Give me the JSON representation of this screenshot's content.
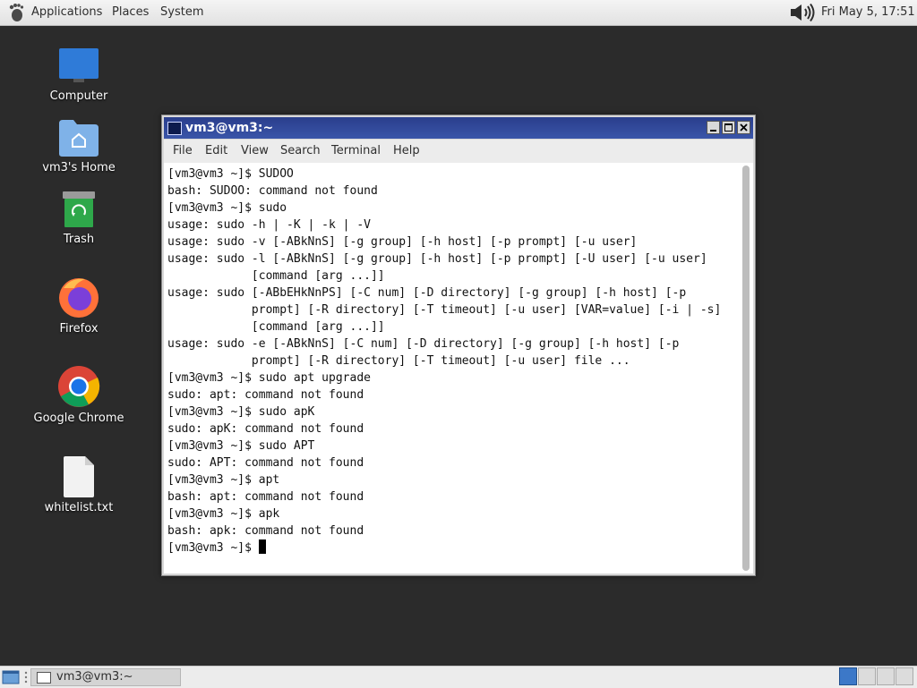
{
  "top_panel": {
    "applications": "Applications",
    "places": "Places",
    "system": "System",
    "clock": "Fri May  5, 17:51"
  },
  "desktop": {
    "icons": [
      {
        "label": "Computer"
      },
      {
        "label": "vm3's Home"
      },
      {
        "label": "Trash"
      },
      {
        "label": "Firefox"
      },
      {
        "label": "Google Chrome"
      },
      {
        "label": "whitelist.txt"
      }
    ]
  },
  "window": {
    "title": "vm3@vm3:~",
    "menu": [
      "File",
      "Edit",
      "View",
      "Search",
      "Terminal",
      "Help"
    ],
    "lines": [
      "[vm3@vm3 ~]$ SUDOO",
      "bash: SUDOO: command not found",
      "[vm3@vm3 ~]$ sudo",
      "usage: sudo -h | -K | -k | -V",
      "usage: sudo -v [-ABkNnS] [-g group] [-h host] [-p prompt] [-u user]",
      "usage: sudo -l [-ABkNnS] [-g group] [-h host] [-p prompt] [-U user] [-u user]",
      "            [command [arg ...]]",
      "usage: sudo [-ABbEHkNnPS] [-C num] [-D directory] [-g group] [-h host] [-p",
      "            prompt] [-R directory] [-T timeout] [-u user] [VAR=value] [-i | -s]",
      "            [command [arg ...]]",
      "usage: sudo -e [-ABkNnS] [-C num] [-D directory] [-g group] [-h host] [-p",
      "            prompt] [-R directory] [-T timeout] [-u user] file ...",
      "[vm3@vm3 ~]$ sudo apt upgrade",
      "sudo: apt: command not found",
      "[vm3@vm3 ~]$ sudo apK",
      "sudo: apK: command not found",
      "[vm3@vm3 ~]$ sudo APT",
      "sudo: APT: command not found",
      "[vm3@vm3 ~]$ apt",
      "bash: apt: command not found",
      "[vm3@vm3 ~]$ apk",
      "bash: apk: command not found"
    ],
    "prompt": "[vm3@vm3 ~]$ "
  },
  "taskbar": {
    "window_label": "vm3@vm3:~"
  },
  "colors": {
    "titlebar": "#2a3e8c",
    "desktop": "#2b2b2b"
  }
}
